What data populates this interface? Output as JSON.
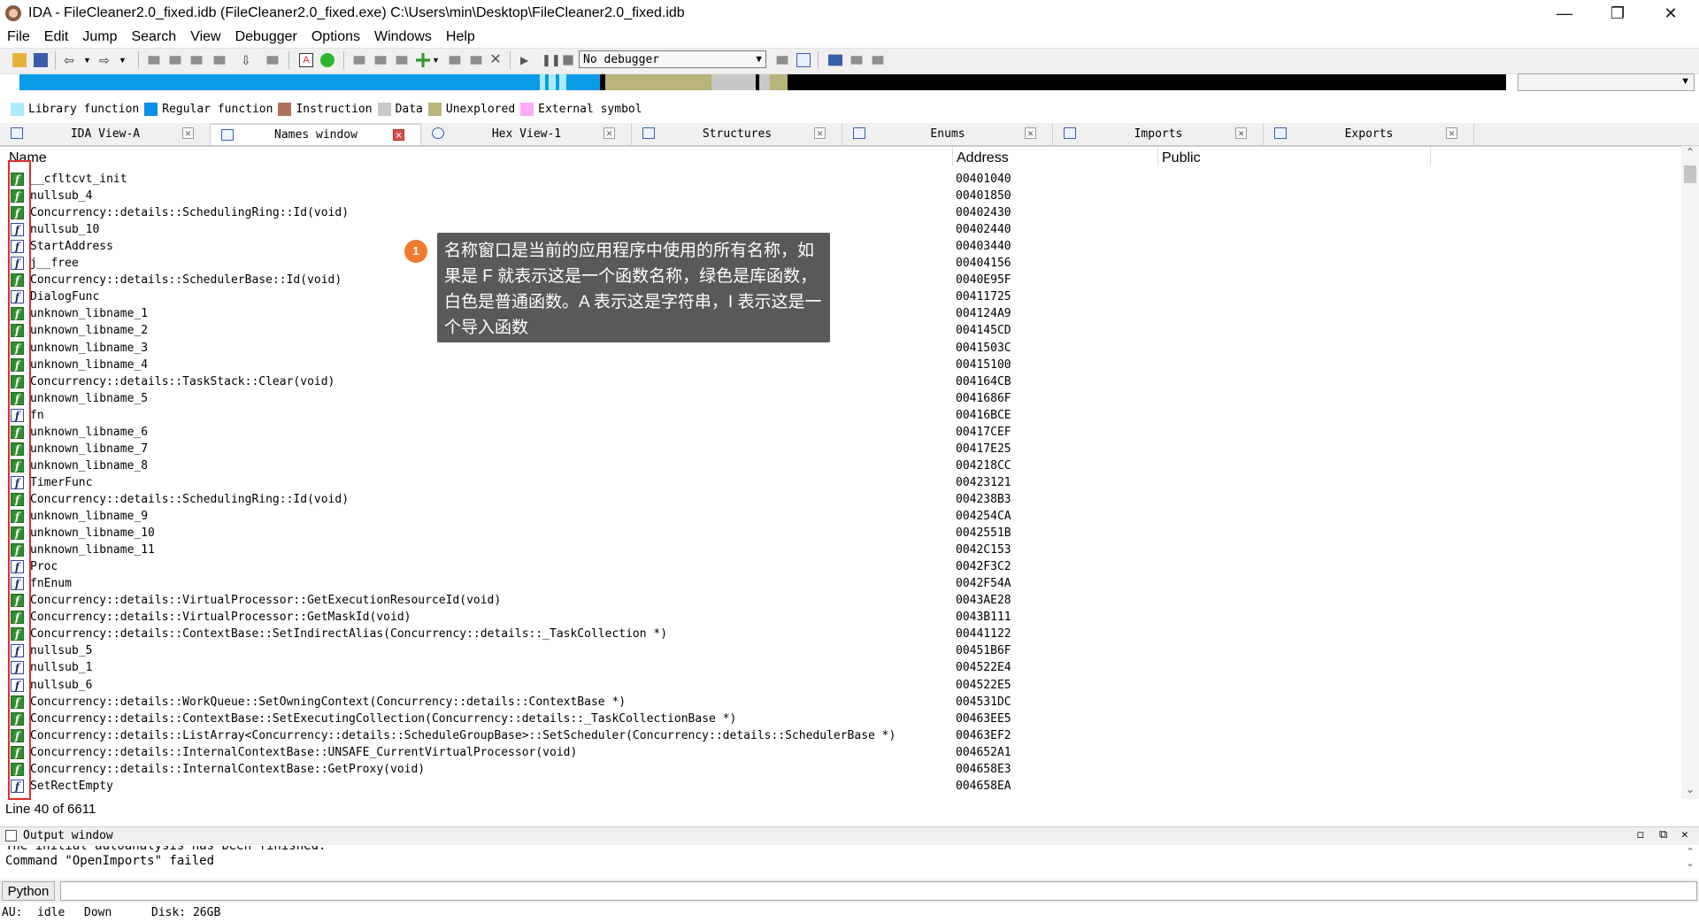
{
  "window": {
    "title": "IDA - FileCleaner2.0_fixed.idb (FileCleaner2.0_fixed.exe) C:\\Users\\min\\Desktop\\FileCleaner2.0_fixed.idb"
  },
  "menu": [
    "File",
    "Edit",
    "Jump",
    "Search",
    "View",
    "Debugger",
    "Options",
    "Windows",
    "Help"
  ],
  "toolbar": {
    "debugger_value": "No debugger"
  },
  "legend": [
    {
      "label": "Library function",
      "color": "#aeeaff"
    },
    {
      "label": "Regular function",
      "color": "#0a8fe6"
    },
    {
      "label": "Instruction",
      "color": "#b0705a"
    },
    {
      "label": "Data",
      "color": "#c8c8c8"
    },
    {
      "label": "Unexplored",
      "color": "#b8b47a"
    },
    {
      "label": "External symbol",
      "color": "#ffaaf6"
    }
  ],
  "tabs": [
    {
      "label": "IDA View-A"
    },
    {
      "label": "Names window"
    },
    {
      "label": "Hex View-1"
    },
    {
      "label": "Structures"
    },
    {
      "label": "Enums"
    },
    {
      "label": "Imports"
    },
    {
      "label": "Exports"
    }
  ],
  "names": {
    "columns": [
      "Name",
      "Address",
      "Public"
    ],
    "rows": [
      {
        "name": "__cfltcvt_init",
        "address": "00401040",
        "kind": "lib"
      },
      {
        "name": "nullsub_4",
        "address": "00401850",
        "kind": "lib"
      },
      {
        "name": "Concurrency::details::SchedulingRing::Id(void)",
        "address": "00402430",
        "kind": "lib"
      },
      {
        "name": "nullsub_10",
        "address": "00402440",
        "kind": "reg"
      },
      {
        "name": "StartAddress",
        "address": "00403440",
        "kind": "reg"
      },
      {
        "name": "j__free",
        "address": "00404156",
        "kind": "reg"
      },
      {
        "name": "Concurrency::details::SchedulerBase::Id(void)",
        "address": "0040E95F",
        "kind": "lib"
      },
      {
        "name": "DialogFunc",
        "address": "00411725",
        "kind": "reg"
      },
      {
        "name": "unknown_libname_1",
        "address": "004124A9",
        "kind": "lib"
      },
      {
        "name": "unknown_libname_2",
        "address": "004145CD",
        "kind": "lib"
      },
      {
        "name": "unknown_libname_3",
        "address": "0041503C",
        "kind": "lib"
      },
      {
        "name": "unknown_libname_4",
        "address": "00415100",
        "kind": "lib"
      },
      {
        "name": "Concurrency::details::TaskStack::Clear(void)",
        "address": "004164CB",
        "kind": "lib"
      },
      {
        "name": "unknown_libname_5",
        "address": "0041686F",
        "kind": "lib"
      },
      {
        "name": "fn",
        "address": "00416BCE",
        "kind": "reg"
      },
      {
        "name": "unknown_libname_6",
        "address": "00417CEF",
        "kind": "lib"
      },
      {
        "name": "unknown_libname_7",
        "address": "00417E25",
        "kind": "lib"
      },
      {
        "name": "unknown_libname_8",
        "address": "004218CC",
        "kind": "lib"
      },
      {
        "name": "TimerFunc",
        "address": "00423121",
        "kind": "reg"
      },
      {
        "name": "Concurrency::details::SchedulingRing::Id(void)",
        "address": "004238B3",
        "kind": "lib"
      },
      {
        "name": "unknown_libname_9",
        "address": "004254CA",
        "kind": "lib"
      },
      {
        "name": "unknown_libname_10",
        "address": "0042551B",
        "kind": "lib"
      },
      {
        "name": "unknown_libname_11",
        "address": "0042C153",
        "kind": "lib"
      },
      {
        "name": "Proc",
        "address": "0042F3C2",
        "kind": "reg"
      },
      {
        "name": "fnEnum",
        "address": "0042F54A",
        "kind": "reg"
      },
      {
        "name": "Concurrency::details::VirtualProcessor::GetExecutionResourceId(void)",
        "address": "0043AE28",
        "kind": "lib"
      },
      {
        "name": "Concurrency::details::VirtualProcessor::GetMaskId(void)",
        "address": "0043B111",
        "kind": "lib"
      },
      {
        "name": "Concurrency::details::ContextBase::SetIndirectAlias(Concurrency::details::_TaskCollection *)",
        "address": "00441122",
        "kind": "lib"
      },
      {
        "name": "nullsub_5",
        "address": "00451B6F",
        "kind": "reg"
      },
      {
        "name": "nullsub_1",
        "address": "004522E4",
        "kind": "reg"
      },
      {
        "name": "nullsub_6",
        "address": "004522E5",
        "kind": "reg"
      },
      {
        "name": "Concurrency::details::WorkQueue::SetOwningContext(Concurrency::details::ContextBase *)",
        "address": "004531DC",
        "kind": "lib"
      },
      {
        "name": "Concurrency::details::ContextBase::SetExecutingCollection(Concurrency::details::_TaskCollectionBase *)",
        "address": "00463EE5",
        "kind": "lib"
      },
      {
        "name": "Concurrency::details::ListArray<Concurrency::details::ScheduleGroupBase>::SetScheduler(Concurrency::details::SchedulerBase *)",
        "address": "00463EF2",
        "kind": "lib"
      },
      {
        "name": "Concurrency::details::InternalContextBase::UNSAFE_CurrentVirtualProcessor(void)",
        "address": "004652A1",
        "kind": "lib"
      },
      {
        "name": "Concurrency::details::InternalContextBase::GetProxy(void)",
        "address": "004658E3",
        "kind": "lib"
      },
      {
        "name": "SetRectEmpty",
        "address": "004658EA",
        "kind": "reg"
      }
    ]
  },
  "callout": {
    "badge": "1",
    "text": "名称窗口是当前的应用程序中使用的所有名称，如果是 F 就表示这是一个函数名称，绿色是库函数，白色是普通函数。A 表示这是字符串，I 表示这是一个导入函数"
  },
  "status": {
    "line": "Line 40 of 6611"
  },
  "output": {
    "title": "Output window",
    "line1": "The initial autoanalysis has been finished.",
    "line2": "Command \"OpenImports\" failed"
  },
  "python": {
    "label": "Python"
  },
  "statusbar": {
    "au": "AU:",
    "state": "idle",
    "dir": "Down",
    "disk": "Disk: 26GB"
  }
}
